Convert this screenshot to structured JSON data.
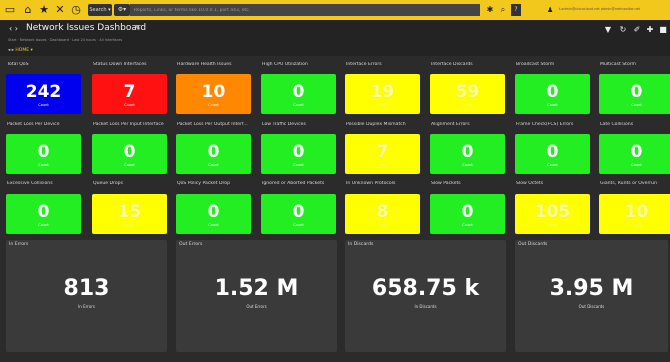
{
  "topbar": {
    "search_label": "Search ▾",
    "filter_label": "⚙▾",
    "search_placeholder": "Reports, Links, or terms like 10.0.0.1, port 443, etc.",
    "user_text": "t.admin@ciscocloud.net   admin@netmonitor.net"
  },
  "header": {
    "nav_glyph": "‹ ›",
    "title": "Network Issues Dashboard",
    "breadcrumb": "Start  ·  Network Issues  ·  Dashboard  ·  Last 24 hours  ·  All Interfaces",
    "home_nav": "◂ ▸",
    "home_label": "HOME ▾"
  },
  "tiles": [
    {
      "label": "Total QoS",
      "value": "242",
      "caption": "Count",
      "color": "#0000ee"
    },
    {
      "label": "Status Down Interfaces",
      "value": "7",
      "caption": "Count",
      "color": "#ff1111"
    },
    {
      "label": "Hardware Health Issues",
      "value": "10",
      "caption": "Count",
      "color": "#ff8800"
    },
    {
      "label": "High CPU Utilization",
      "value": "0",
      "caption": "Count",
      "color": "#22ee22"
    },
    {
      "label": "Interface Errors",
      "value": "19",
      "caption": "Count",
      "color": "#ffff00"
    },
    {
      "label": "Interface Discards",
      "value": "59",
      "caption": "Count",
      "color": "#ffff00"
    },
    {
      "label": "Broadcast Storm",
      "value": "0",
      "caption": "Count",
      "color": "#22ee22"
    },
    {
      "label": "Multicast Storm",
      "value": "0",
      "caption": "Count",
      "color": "#22ee22"
    },
    {
      "label": "Packet Loss Per Device",
      "value": "0",
      "caption": "Count",
      "color": "#22ee22"
    },
    {
      "label": "Packet Loss Per Input Interface",
      "value": "0",
      "caption": "Count",
      "color": "#22ee22"
    },
    {
      "label": "Packet Loss Per Output Interf...",
      "value": "0",
      "caption": "Count",
      "color": "#22ee22"
    },
    {
      "label": "Low Traffic Devices",
      "value": "0",
      "caption": "Count",
      "color": "#22ee22"
    },
    {
      "label": "Possible Duplex Mismatch",
      "value": "7",
      "caption": "Count",
      "color": "#ffff00"
    },
    {
      "label": "Alignment Errors",
      "value": "0",
      "caption": "Count",
      "color": "#22ee22"
    },
    {
      "label": "Frame Check(FCS) Errors",
      "value": "0",
      "caption": "Count",
      "color": "#22ee22"
    },
    {
      "label": "Late Collisions",
      "value": "0",
      "caption": "Count",
      "color": "#22ee22"
    },
    {
      "label": "Excessive Collisions",
      "value": "0",
      "caption": "Count",
      "color": "#22ee22"
    },
    {
      "label": "Queue Drops",
      "value": "15",
      "caption": "Count",
      "color": "#ffff00"
    },
    {
      "label": "QoS Policy Packet Drop",
      "value": "0",
      "caption": "Count",
      "color": "#22ee22"
    },
    {
      "label": "Ignored or Aborted Packets",
      "value": "0",
      "caption": "Count",
      "color": "#22ee22"
    },
    {
      "label": "In Unknown Protocols",
      "value": "8",
      "caption": "Count",
      "color": "#ffff00"
    },
    {
      "label": "Slow Packets",
      "value": "0",
      "caption": "Count",
      "color": "#22ee22"
    },
    {
      "label": "Slow Octets",
      "value": "105",
      "caption": "Count",
      "color": "#ffff00"
    },
    {
      "label": "Giants, Runts or Overrun",
      "value": "10",
      "caption": "Count",
      "color": "#ffff00"
    }
  ],
  "bigs": [
    {
      "label": "In Errors",
      "value": "813",
      "caption": "In Errors"
    },
    {
      "label": "Out Errors",
      "value": "1.52 M",
      "caption": "Out Errors"
    },
    {
      "label": "In Discards",
      "value": "658.75 k",
      "caption": "In Discards"
    },
    {
      "label": "Out Discards",
      "value": "3.95 M",
      "caption": "Out Discards"
    }
  ]
}
